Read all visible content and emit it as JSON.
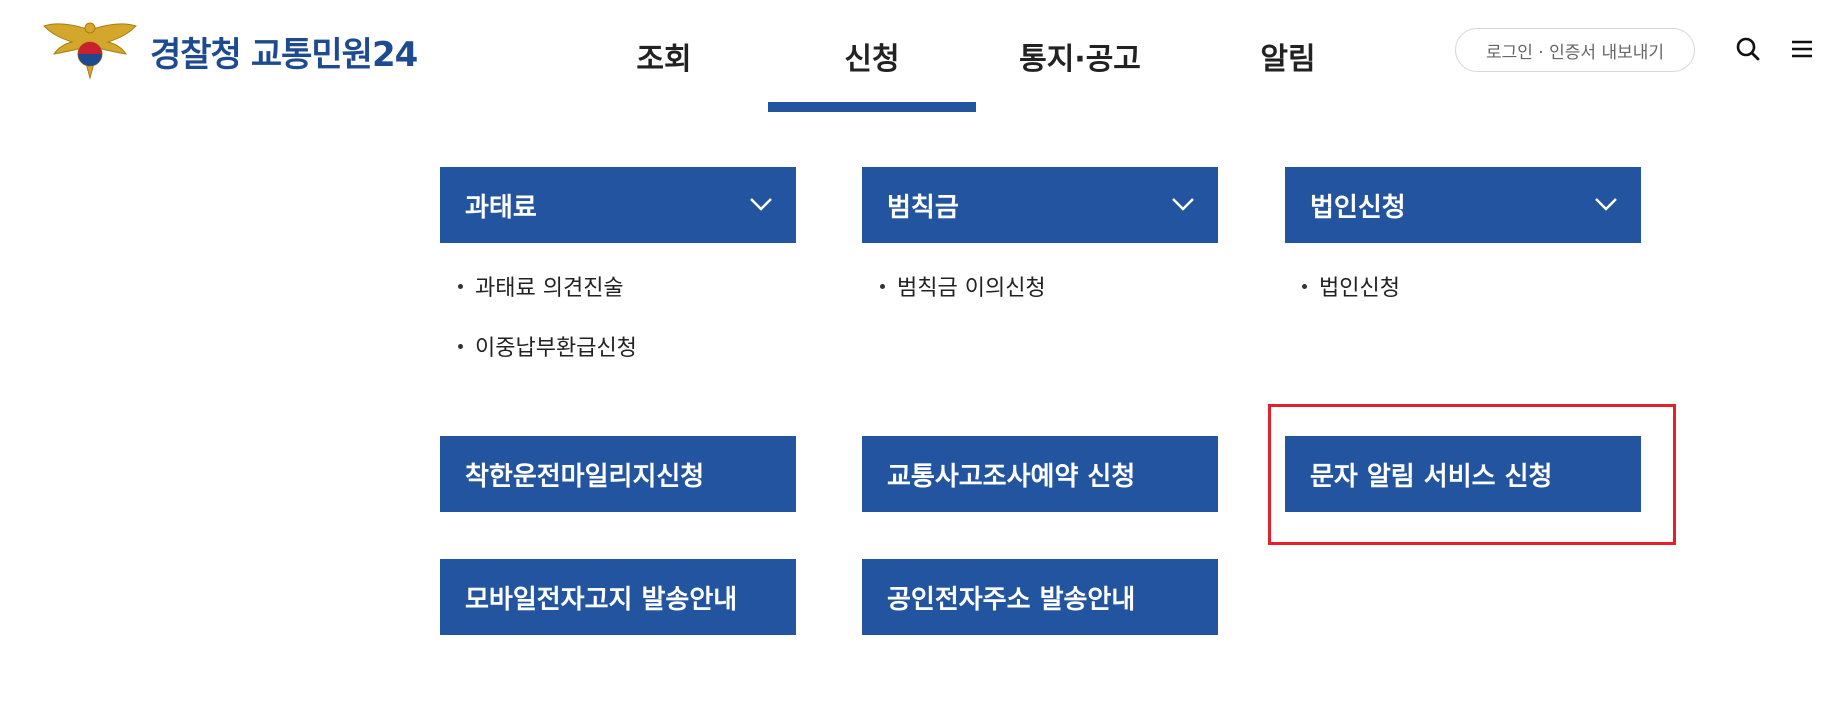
{
  "header": {
    "logo": {
      "agency": "경찰청",
      "service": "교통민원24"
    },
    "nav": [
      {
        "label": "조회"
      },
      {
        "label": "신청",
        "active": true
      },
      {
        "label": "통지·공고"
      },
      {
        "label": "알림"
      }
    ],
    "login_label": "로그인 · 인증서 내보내기",
    "icons": {
      "search": "search-icon",
      "menu": "hamburger-menu-icon"
    }
  },
  "menu": {
    "categories": [
      {
        "title": "과태료",
        "items": [
          "과태료 의견진술",
          "이중납부환급신청"
        ]
      },
      {
        "title": "범칙금",
        "items": [
          "범칙금 이의신청"
        ]
      },
      {
        "title": "법인신청",
        "items": [
          "법인신청"
        ]
      }
    ],
    "links": [
      "착한운전마일리지신청",
      "교통사고조사예약 신청",
      "문자 알림 서비스 신청",
      "모바일전자고지 발송안내",
      "공인전자주소 발송안내"
    ]
  },
  "colors": {
    "brand_blue": "#2354a0",
    "highlight_red": "#e3202c"
  }
}
